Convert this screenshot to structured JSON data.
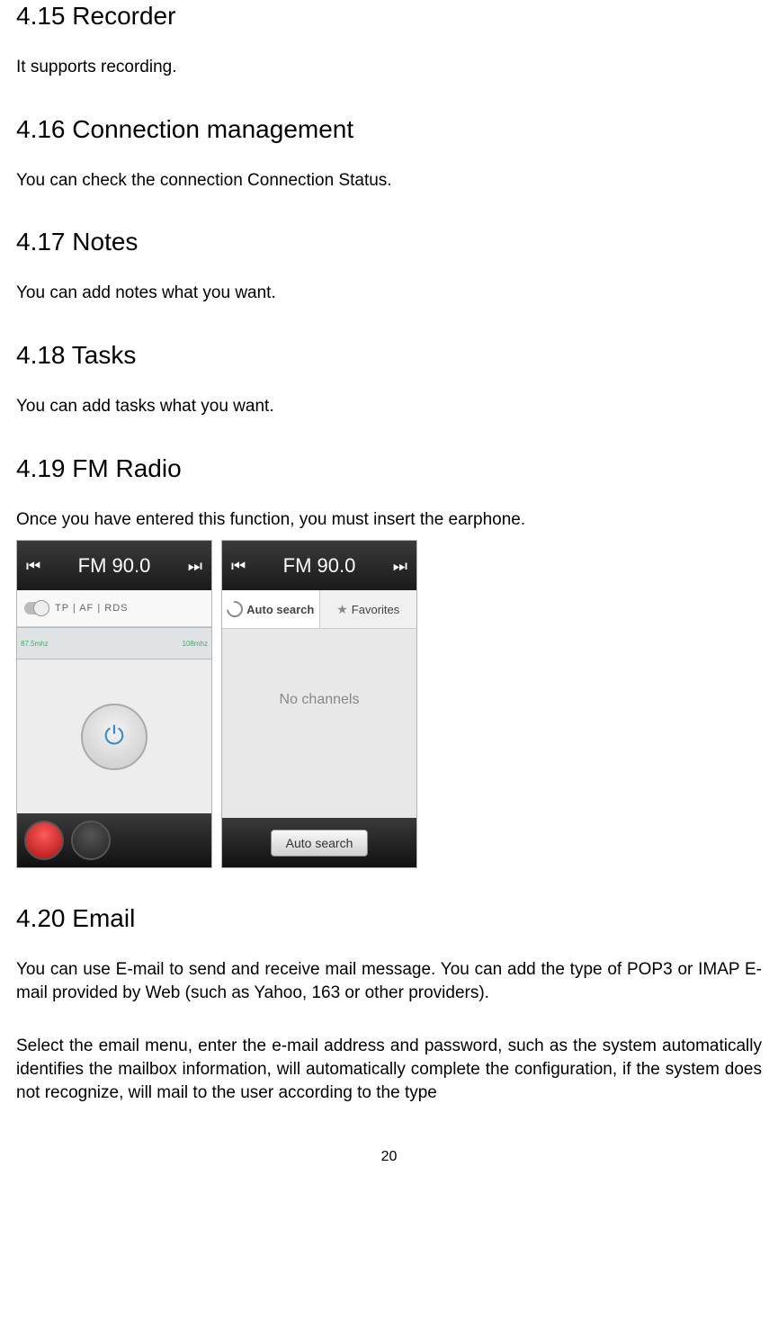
{
  "sections": {
    "s415": {
      "heading": "4.15 Recorder",
      "body": "It supports recording."
    },
    "s416": {
      "heading": "4.16 Connection management",
      "body": "You can check the connection Connection Status."
    },
    "s417": {
      "heading": "4.17 Notes",
      "body": "You can add notes what you want."
    },
    "s418": {
      "heading": "4.18 Tasks",
      "body": "You can add tasks what you want."
    },
    "s419": {
      "heading": "4.19 FM Radio",
      "body": "Once you have entered this function, you must insert the earphone."
    },
    "s420": {
      "heading": "4.20 Email",
      "body1": "You can use E-mail to send and receive mail message. You can add the type of POP3 or IMAP E-mail provided by Web (such as Yahoo, 163 or other providers).",
      "body2": "Select the email menu, enter the e-mail address and password, such as the system automatically identifies the mailbox information, will automatically complete the configuration, if the system does not recognize, will mail to the user according to the type"
    }
  },
  "fm": {
    "frequency": "FM 90.0",
    "tp_label": "TP | AF | RDS",
    "scale_low": "87.5mhz",
    "scale_high": "108mhz",
    "tab_auto": "Auto search",
    "tab_fav": "Favorites",
    "no_channels": "No channels",
    "search_btn": "Auto search"
  },
  "page_number": "20"
}
